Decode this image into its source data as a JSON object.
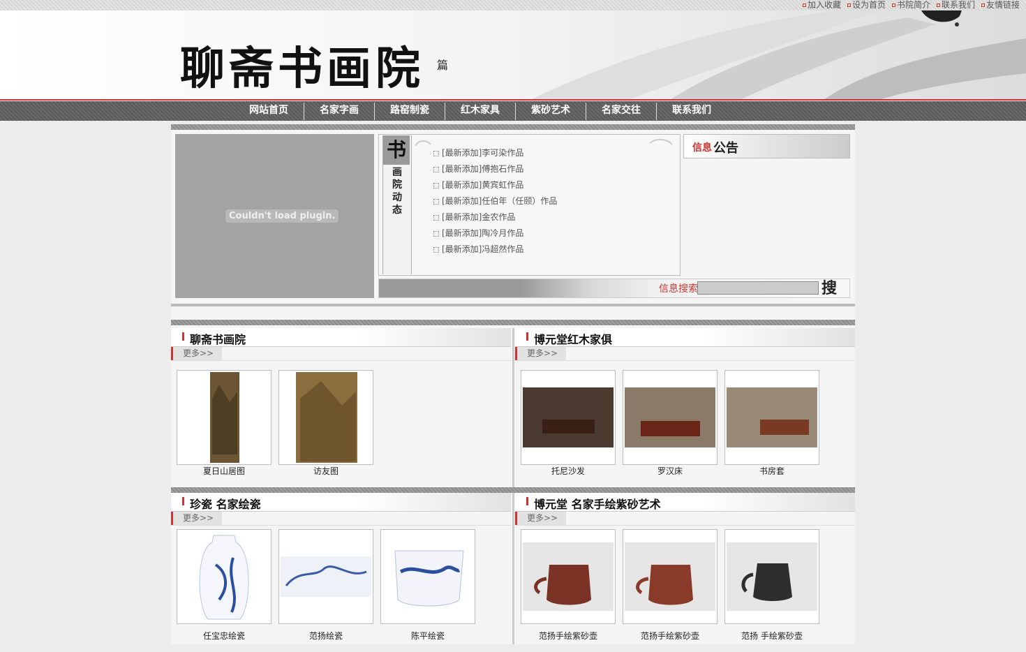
{
  "top_links": [
    "加入收藏",
    "设为首页",
    "书院简介",
    "联系我们",
    "友情链接"
  ],
  "banner": {
    "logo_text": "聊斋书画院",
    "seal": "篇"
  },
  "nav": [
    "网站首页",
    "名家字画",
    "路窑制瓷",
    "红木家具",
    "紫砂艺术",
    "名家交往",
    "联系我们"
  ],
  "plugin": {
    "message": "Couldn't load plugin."
  },
  "news": {
    "title_big": "书",
    "title_vertical": [
      "画",
      "院",
      "动",
      "态"
    ],
    "items": [
      "[最新添加]李可染作品",
      "[最新添加]傅抱石作品",
      "[最新添加]黄宾虹作品",
      "[最新添加]任伯年（任颐）作品",
      "[最新添加]金农作品",
      "[最新添加]陶冷月作品",
      "[最新添加]冯超然作品"
    ]
  },
  "search": {
    "label": "信息搜索",
    "button": "搜"
  },
  "notice": {
    "t1": "信息",
    "t2": "公告"
  },
  "sections": [
    {
      "title": "聊斋书画院",
      "more": "更多>>",
      "items": [
        "夏日山居图",
        "访友图"
      ]
    },
    {
      "title": "博元堂红木家俱",
      "more": "更多>>",
      "items": [
        "托尼沙发",
        "罗汉床",
        "书房套"
      ]
    },
    {
      "title": "珍瓷 名家绘瓷",
      "more": "更多>>",
      "items": [
        "任宝忠绘瓷",
        "范扬绘瓷",
        "陈平绘瓷"
      ]
    },
    {
      "title": "博元堂 名家手绘紫砂艺术",
      "more": "更多>>",
      "items": [
        "范扬手绘紫砂壶",
        "范扬手绘紫砂壶",
        "范扬 手绘紫砂壶"
      ]
    }
  ],
  "colors": {
    "accent": "#cc3333",
    "nav_bg": "#606060",
    "plugin_bg": "#a3a3a3"
  }
}
